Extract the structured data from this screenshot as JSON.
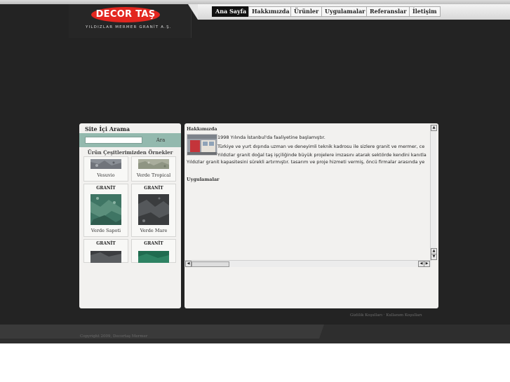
{
  "brand": {
    "logo_text": "DECOR TAŞ",
    "subtitle": "YILDIZLAR MERMER GRANİT A.Ş."
  },
  "nav": {
    "items": [
      {
        "label": "Ana Sayfa",
        "active": true
      },
      {
        "label": "Hakkımızda",
        "active": false
      },
      {
        "label": "Ürünler",
        "active": false
      },
      {
        "label": "Uygulamalar",
        "active": false
      },
      {
        "label": "Referanslar",
        "active": false
      },
      {
        "label": "İletişim",
        "active": false
      }
    ]
  },
  "search": {
    "title": "Site İçi Arama",
    "value": "",
    "placeholder": "",
    "button_label": "Ara"
  },
  "samples": {
    "title": "Ürün Çeşitlerimizden Örnekler",
    "cards": [
      {
        "type": "",
        "name": "Vesuvio"
      },
      {
        "type": "",
        "name": "Verde Tropical"
      },
      {
        "type": "GRANİT",
        "name": "Verde Sapoti"
      },
      {
        "type": "GRANİT",
        "name": "Verde Mare"
      },
      {
        "type": "GRANİT",
        "name": ""
      },
      {
        "type": "GRANİT",
        "name": ""
      }
    ]
  },
  "content": {
    "about_heading": "Hakkımızda",
    "about_lines": [
      "1998 Yılında İstanbul'da faaliyetine başlamıştır.",
      "Türkiye ve yurt dışında uzman ve deneyimli teknik kadrosu ile sizlere granit ve mermer, ce",
      "Yıldızlar granit doğal taş işçiliğinde büyük projelere imzasını atarak sektörde kendini kanıtla",
      "Yıldızlar granit kapasitesini sürekli artırmıştır. tasarım ve proje hizmeti vermiş, öncü firmalar arasında ye"
    ],
    "applications_heading": "Uygulamalar"
  },
  "footer": {
    "privacy_link": "Gizlilik Koşulları",
    "separator": " · ",
    "terms_link": "Kullanım Koşulları",
    "copyright": "Copyright 2009, Decortaş Mermer"
  },
  "colors": {
    "background": "#232323",
    "logo_red": "#e3261f",
    "search_bar": "#93b9ae",
    "panel": "#f2f1ef"
  },
  "icons": {
    "scroll_up": "▲",
    "scroll_down": "▼",
    "scroll_left": "◀",
    "scroll_right": "▶"
  }
}
